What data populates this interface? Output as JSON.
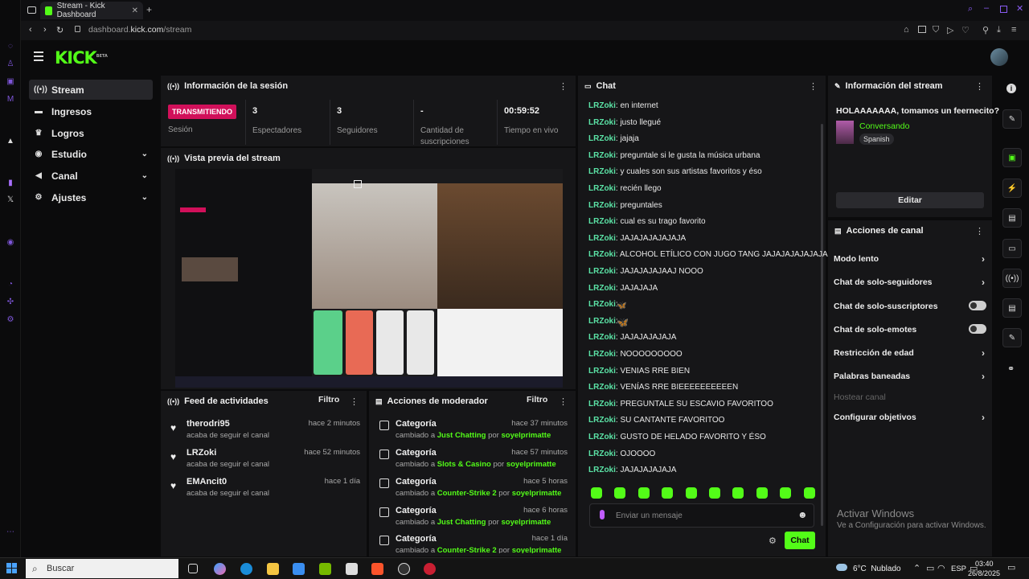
{
  "browser": {
    "tab_title": "Stream - Kick Dashboard",
    "url_host": "dashboard.",
    "url_domain": "kick.com",
    "url_path": "/stream"
  },
  "app": {
    "logo": "KICK",
    "logo_sup": "BETA"
  },
  "nav": [
    {
      "label": "Stream",
      "icon": "broadcast-icon"
    },
    {
      "label": "Ingresos",
      "icon": "wallet-icon"
    },
    {
      "label": "Logros",
      "icon": "trophy-icon"
    },
    {
      "label": "Estudio",
      "icon": "studio-icon"
    },
    {
      "label": "Canal",
      "icon": "channel-icon"
    },
    {
      "label": "Ajustes",
      "icon": "gear-icon"
    }
  ],
  "session": {
    "title": "Información de la sesión",
    "badge": "TRANSMITIENDO",
    "badge_label": "Sesión",
    "viewers_value": "3",
    "viewers_label": "Espectadores",
    "followers_value": "3",
    "followers_label": "Seguidores",
    "subs_value": "-",
    "subs_label": "Cantidad de suscripciones",
    "live_value": "00:59:52",
    "live_label": "Tiempo en vivo"
  },
  "preview": {
    "title": "Vista previa del stream"
  },
  "feed": {
    "title": "Feed de actividades",
    "filter": "Filtro",
    "items": [
      {
        "name": "therodri95",
        "sub": "acaba de seguir el canal",
        "time": "hace 2 minutos"
      },
      {
        "name": "LRZoki",
        "sub": "acaba de seguir el canal",
        "time": "hace 52 minutos"
      },
      {
        "name": "EMAncit0",
        "sub": "acaba de seguir el canal",
        "time": "hace 1 día"
      }
    ]
  },
  "mod": {
    "title": "Acciones de moderador",
    "filter": "Filtro",
    "items": [
      {
        "name": "Categoría",
        "pre": "cambiado a ",
        "cat": "Just Chatting",
        "mid": " por ",
        "user": "soyelprimatte",
        "time": "hace 37 minutos"
      },
      {
        "name": "Categoría",
        "pre": "cambiado a ",
        "cat": "Slots & Casino",
        "mid": " por ",
        "user": "soyelprimatte",
        "time": "hace 57 minutos"
      },
      {
        "name": "Categoría",
        "pre": "cambiado a ",
        "cat": "Counter-Strike 2",
        "mid": " por ",
        "user": "soyelprimatte",
        "time": "hace 5 horas"
      },
      {
        "name": "Categoría",
        "pre": "cambiado a ",
        "cat": "Just Chatting",
        "mid": " por ",
        "user": "soyelprimatte",
        "time": "hace 6 horas"
      },
      {
        "name": "Categoría",
        "pre": "cambiado a ",
        "cat": "Counter-Strike 2",
        "mid": " por ",
        "user": "soyelprimatte",
        "time": "hace 1 día"
      }
    ]
  },
  "chat": {
    "title": "Chat",
    "placeholder": "Enviar un mensaje",
    "send": "Chat",
    "messages": [
      {
        "user": "LRZoki",
        "text": ": en internet"
      },
      {
        "user": "LRZoki",
        "text": ": justo llegué"
      },
      {
        "user": "LRZoki",
        "text": ": jajaja"
      },
      {
        "user": "LRZoki",
        "text": ": preguntale si le gusta la música urbana"
      },
      {
        "user": "LRZoki",
        "text": ": y cuales son sus artistas favoritos y éso"
      },
      {
        "user": "LRZoki",
        "text": ": recién llego"
      },
      {
        "user": "LRZoki",
        "text": ": preguntales"
      },
      {
        "user": "LRZoki",
        "text": ": cual es su trago favorito"
      },
      {
        "user": "LRZoki",
        "text": ": JAJAJAJAJAJAJA"
      },
      {
        "user": "LRZoki",
        "text": ": ALCOHOL ETÍLICO CON JUGO TANG JAJAJAJAJAJAJA"
      },
      {
        "user": "LRZoki",
        "text": ": JAJAJAJAJAAJ NOOO"
      },
      {
        "user": "LRZoki",
        "text": ": JAJAJAJA"
      },
      {
        "user": "LRZoki",
        "text": ": "
      },
      {
        "user": "LRZoki",
        "text": ": "
      },
      {
        "user": "LRZoki",
        "text": ": JAJAJAJAJAJA"
      },
      {
        "user": "LRZoki",
        "text": ": NOOOOOOOOO"
      },
      {
        "user": "LRZoki",
        "text": ": VENIAS RRE BIEN"
      },
      {
        "user": "LRZoki",
        "text": ": VENÍAS RRE BIEEEEEEEEEEN"
      },
      {
        "user": "LRZoki",
        "text": ": PREGUNTALE SU ESCAVIO FAVORITOO"
      },
      {
        "user": "LRZoki",
        "text": ": SU CANTANTE FAVORITOO"
      },
      {
        "user": "LRZoki",
        "text": ": GUSTO DE HELADO FAVORITO Y ÉSO"
      },
      {
        "user": "LRZoki",
        "text": ": OJOOOO"
      },
      {
        "user": "LRZoki",
        "text": ": JAJAJAJAJAJA"
      }
    ]
  },
  "stream_info": {
    "title": "Información del stream",
    "stream_title": "HOLAAAAAAA, tomamos un feernecito?",
    "category": "Conversando",
    "language": "Spanish",
    "edit": "Editar"
  },
  "actions": {
    "title": "Acciones de canal",
    "items": [
      {
        "label": "Modo lento",
        "type": "chevron"
      },
      {
        "label": "Chat de solo-seguidores",
        "type": "chevron"
      },
      {
        "label": "Chat de solo-suscriptores",
        "type": "toggle"
      },
      {
        "label": "Chat de solo-emotes",
        "type": "toggle"
      },
      {
        "label": "Restricción de edad",
        "type": "chevron"
      },
      {
        "label": "Palabras baneadas",
        "type": "chevron"
      },
      {
        "label": "Hostear canal",
        "type": "disabled"
      },
      {
        "label": "Configurar objetivos",
        "type": "chevron"
      }
    ]
  },
  "windows": {
    "activate_title": "Activar Windows",
    "activate_sub": "Ve a Configuración para activar Windows.",
    "search": "Buscar",
    "weather": "6°C  Nublado",
    "lang": "ESP",
    "time": "03:40",
    "date": "26/8/2025"
  },
  "colors": {
    "accent": "#53fc18",
    "live": "#d1105a",
    "chat_user": "#5be3a6"
  }
}
